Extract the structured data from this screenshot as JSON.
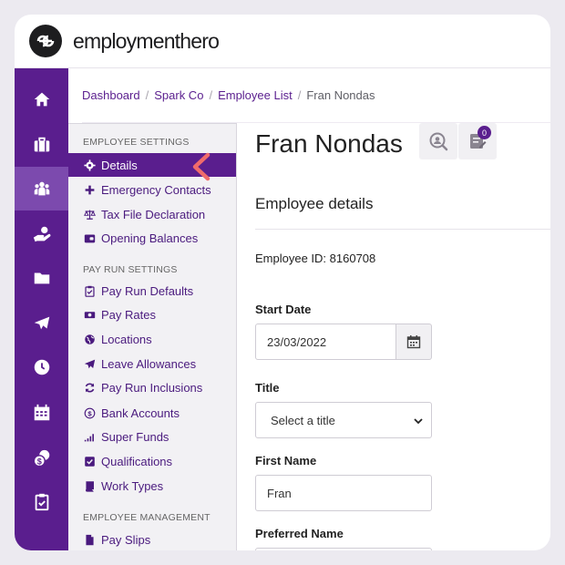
{
  "brand": {
    "name": "employmenthero"
  },
  "breadcrumb": [
    {
      "label": "Dashboard"
    },
    {
      "label": "Spark Co"
    },
    {
      "label": "Employee List"
    },
    {
      "label": "Fran Nondas"
    }
  ],
  "sidebar": {
    "rail_icons": [
      "home-icon",
      "briefcase-icon",
      "people-icon",
      "payroll-hand-icon",
      "folder-icon",
      "plane-icon",
      "clock-icon",
      "calendar-icon",
      "coins-icon",
      "clipboard-icon"
    ]
  },
  "subnav": {
    "sections": [
      {
        "heading": "EMPLOYEE SETTINGS",
        "items": [
          {
            "label": "Details",
            "icon": "gear-icon"
          },
          {
            "label": "Emergency Contacts",
            "icon": "plus-icon"
          },
          {
            "label": "Tax File Declaration",
            "icon": "scales-icon"
          },
          {
            "label": "Opening Balances",
            "icon": "wallet-icon"
          }
        ]
      },
      {
        "heading": "PAY RUN SETTINGS",
        "items": [
          {
            "label": "Pay Run Defaults",
            "icon": "clipboard-check-icon"
          },
          {
            "label": "Pay Rates",
            "icon": "money-icon"
          },
          {
            "label": "Locations",
            "icon": "globe-icon"
          },
          {
            "label": "Leave Allowances",
            "icon": "plane-icon"
          },
          {
            "label": "Pay Run Inclusions",
            "icon": "refresh-icon"
          },
          {
            "label": "Bank Accounts",
            "icon": "dollar-circle-icon"
          },
          {
            "label": "Super Funds",
            "icon": "signal-bars-icon"
          },
          {
            "label": "Qualifications",
            "icon": "check-square-icon"
          },
          {
            "label": "Work Types",
            "icon": "book-icon"
          }
        ]
      },
      {
        "heading": "EMPLOYEE MANAGEMENT",
        "items": [
          {
            "label": "Pay Slips",
            "icon": "file-icon"
          }
        ]
      }
    ]
  },
  "main": {
    "title": "Fran Nondas",
    "notes_badge": "0",
    "section_title": "Employee details",
    "employee_id": "Employee ID: 8160708",
    "start_date": {
      "label": "Start Date",
      "value": "23/03/2022"
    },
    "title_field": {
      "label": "Title",
      "value": "Select a title"
    },
    "first_name": {
      "label": "First Name",
      "value": "Fran"
    },
    "preferred_name": {
      "label": "Preferred Name",
      "value": ""
    }
  },
  "colors": {
    "primary": "#5a1e8e",
    "accent_pointer": "#f06b6b"
  }
}
